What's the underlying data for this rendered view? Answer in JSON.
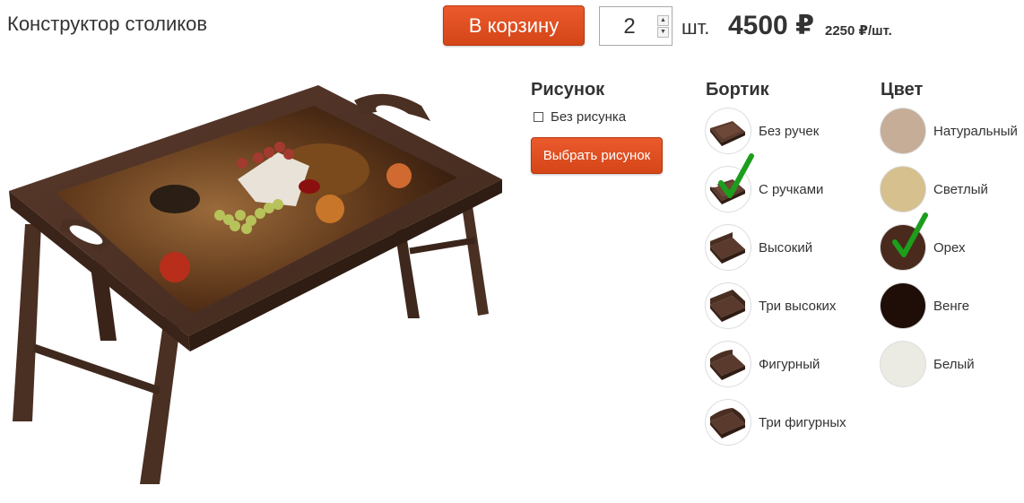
{
  "header": {
    "title": "Конструктор столиков",
    "cart_button": "В корзину",
    "quantity": "2",
    "unit": "шт.",
    "price": "4500 ₽",
    "price_per_unit": "2250 ₽/шт."
  },
  "picture_section": {
    "heading": "Рисунок",
    "no_picture_label": "Без рисунка",
    "no_picture_checked": false,
    "choose_button": "Выбрать рисунок"
  },
  "rim_section": {
    "heading": "Бортик",
    "selected": "С ручками",
    "options": [
      {
        "label": "Без ручек"
      },
      {
        "label": "С ручками"
      },
      {
        "label": "Высокий"
      },
      {
        "label": "Три высоких"
      },
      {
        "label": "Фигурный"
      },
      {
        "label": "Три фигурных"
      }
    ]
  },
  "color_section": {
    "heading": "Цвет",
    "selected": "Орех",
    "options": [
      {
        "label": "Натуральный",
        "color": "#c6ad97"
      },
      {
        "label": "Светлый",
        "color": "#d5c08e"
      },
      {
        "label": "Орех",
        "color": "#4a2a1c"
      },
      {
        "label": "Венге",
        "color": "#1f0e08"
      },
      {
        "label": "Белый",
        "color": "#ecebe3"
      }
    ]
  },
  "colors": {
    "accent": "#df4e20",
    "check": "#1c9e1c",
    "wood": "#4a2e22"
  }
}
